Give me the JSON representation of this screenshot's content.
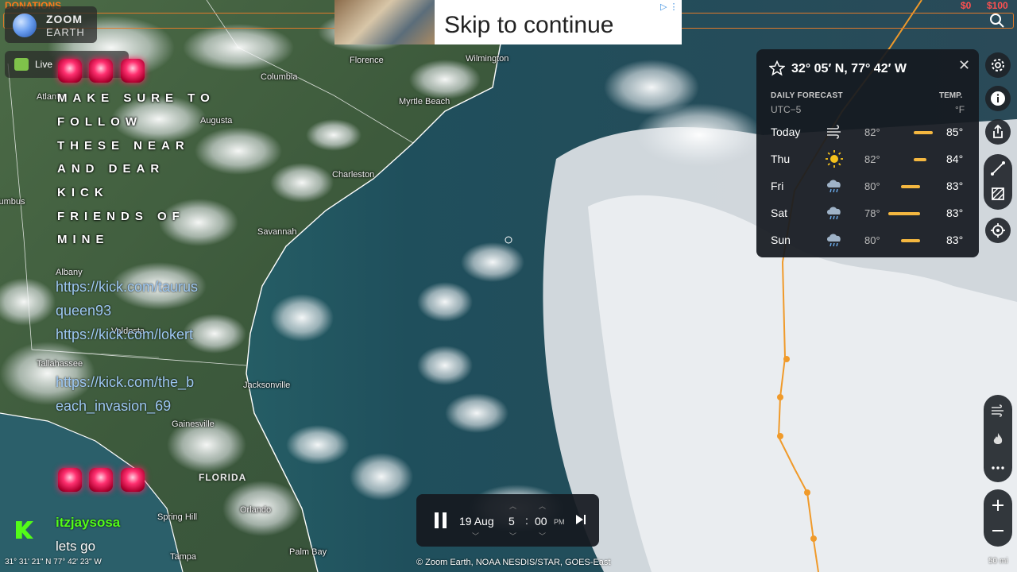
{
  "top_bar": {
    "donations_label": "DONATIONS",
    "goal_left": "$0",
    "goal_right": "$100",
    "accent_color": "#e07a2a"
  },
  "logo": {
    "line1": "ZOOM",
    "line2": "EARTH"
  },
  "ad": {
    "text": "Skip to continue",
    "icon": "adchoices-icon"
  },
  "live_button": {
    "label": "Live"
  },
  "overlay": {
    "lines": [
      "MAKE SURE TO",
      "FOLLOW",
      "THESE NEAR",
      "AND DEAR",
      "KICK",
      "FRIENDS OF",
      "MINE"
    ],
    "links": [
      "https://kick.com/taurusqueen93",
      "https://kick.com/lokert",
      "https://kick.com/the_beach_invasion_69"
    ],
    "siren_icon": "siren-icon"
  },
  "chat": {
    "username": "itzjaysosa",
    "message": "lets go",
    "user_color": "#53fc18"
  },
  "map_labels": {
    "cities": [
      "Florence",
      "Wilmington",
      "Columbia",
      "Myrtle Beach",
      "Augusta",
      "Atlanta",
      "Charleston",
      "Columbus",
      "Savannah",
      "Albany",
      "Valdosta",
      "Tallahassee",
      "Jacksonville",
      "Gainesville",
      "Orlando",
      "Spring Hill",
      "Tampa",
      "Palm Bay"
    ],
    "state": "FLORIDA"
  },
  "status": {
    "cursor_coords": "31° 31' 21\" N  77° 42' 23\" W",
    "attribution": "© Zoom Earth, NOAA NESDIS/STAR, GOES-East",
    "scale": "50 mi"
  },
  "forecast": {
    "title": "32° 05′ N, 77° 42′ W",
    "daily_label": "DAILY FORECAST",
    "timezone": "UTC−5",
    "temp_label": "TEMP.",
    "unit": "°F",
    "bar_color": "#f4b740",
    "days": [
      {
        "day": "Today",
        "icon": "wind-icon",
        "low": "82°",
        "high": "85°",
        "range": [
          82,
          85
        ]
      },
      {
        "day": "Thu",
        "icon": "sun-icon",
        "low": "82°",
        "high": "84°",
        "range": [
          82,
          84
        ]
      },
      {
        "day": "Fri",
        "icon": "rain-icon",
        "low": "80°",
        "high": "83°",
        "range": [
          80,
          83
        ]
      },
      {
        "day": "Sat",
        "icon": "rain-icon",
        "low": "78°",
        "high": "83°",
        "range": [
          78,
          83
        ]
      },
      {
        "day": "Sun",
        "icon": "rain-icon",
        "low": "80°",
        "high": "83°",
        "range": [
          80,
          83
        ]
      }
    ]
  },
  "toolbar": {
    "top": [
      "gear-icon",
      "info-icon",
      "share-icon",
      "measure-icon",
      "area-icon",
      "locate-icon"
    ],
    "layers": [
      "wind-layer-icon",
      "fire-layer-icon",
      "more-icon"
    ],
    "zoom": [
      "zoom-in-icon",
      "zoom-out-icon"
    ]
  },
  "time": {
    "date": "19 Aug",
    "hour": "5",
    "minute": "00",
    "ampm": "PM",
    "playing": false
  },
  "storm_track_color": "#f09a2a"
}
